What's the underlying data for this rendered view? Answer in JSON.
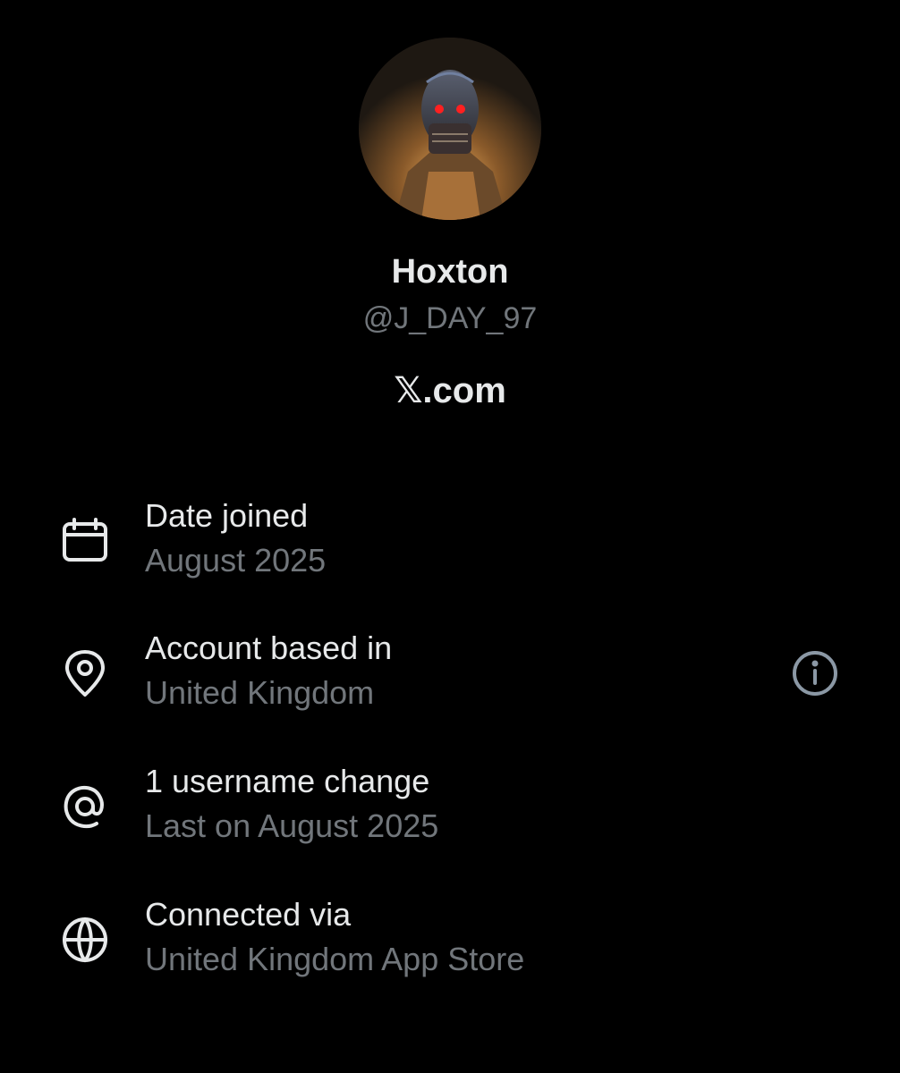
{
  "profile": {
    "display_name": "Hoxton",
    "handle": "@J_DAY_97",
    "brand": "𝕏.com"
  },
  "details": [
    {
      "icon": "calendar-icon",
      "label": "Date joined",
      "value": "August 2025"
    },
    {
      "icon": "location-pin-icon",
      "label": "Account based in",
      "value": "United Kingdom"
    },
    {
      "icon": "at-sign-icon",
      "label": "1 username change",
      "value": "Last on August 2025"
    },
    {
      "icon": "globe-icon",
      "label": "Connected via",
      "value": "United Kingdom App Store"
    }
  ],
  "colors": {
    "background": "#000000",
    "primary_text": "#e7e9ea",
    "secondary_text": "#71767b"
  }
}
